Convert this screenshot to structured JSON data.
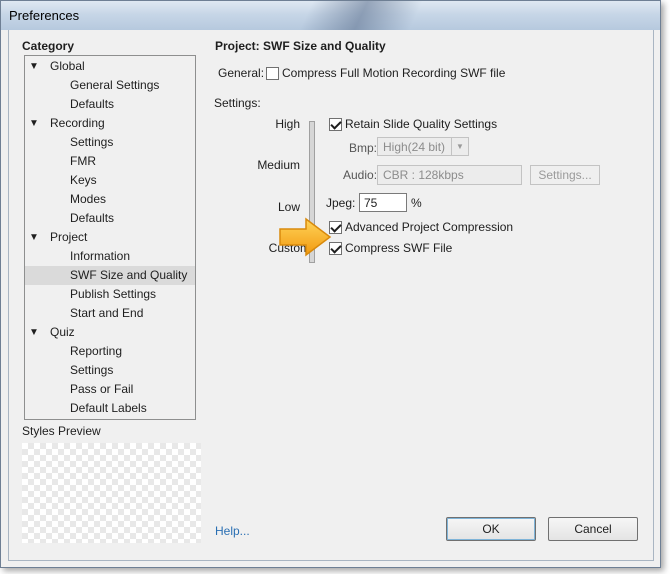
{
  "window": {
    "title": "Preferences"
  },
  "category": {
    "label": "Category",
    "items": [
      {
        "label": "Global",
        "level": 0,
        "expanded": true
      },
      {
        "label": "General Settings",
        "level": 1
      },
      {
        "label": "Defaults",
        "level": 1
      },
      {
        "label": "Recording",
        "level": 0,
        "expanded": true
      },
      {
        "label": "Settings",
        "level": 1
      },
      {
        "label": "FMR",
        "level": 1
      },
      {
        "label": "Keys",
        "level": 1
      },
      {
        "label": "Modes",
        "level": 1
      },
      {
        "label": "Defaults",
        "level": 1
      },
      {
        "label": "Project",
        "level": 0,
        "expanded": true
      },
      {
        "label": "Information",
        "level": 1
      },
      {
        "label": "SWF Size and Quality",
        "level": 1,
        "selected": true
      },
      {
        "label": "Publish Settings",
        "level": 1
      },
      {
        "label": "Start and End",
        "level": 1
      },
      {
        "label": "Quiz",
        "level": 0,
        "expanded": true
      },
      {
        "label": "Reporting",
        "level": 1
      },
      {
        "label": "Settings",
        "level": 1
      },
      {
        "label": "Pass or Fail",
        "level": 1
      },
      {
        "label": "Default Labels",
        "level": 1
      }
    ]
  },
  "styles_preview": {
    "label": "Styles Preview"
  },
  "panel": {
    "title": "Project: SWF Size and Quality",
    "general_label": "General:",
    "compress_fmr": {
      "label": "Compress Full Motion Recording SWF file",
      "checked": false
    },
    "settings_label": "Settings:",
    "slider": {
      "labels": {
        "high": "High",
        "medium": "Medium",
        "low": "Low",
        "custom": "Custom"
      },
      "selected": "Custom"
    },
    "retain_quality": {
      "label": "Retain Slide Quality Settings",
      "checked": true
    },
    "bmp": {
      "label": "Bmp:",
      "value": "High(24 bit)",
      "disabled": true
    },
    "audio": {
      "label": "Audio:",
      "value": "CBR : 128kbps",
      "disabled": true,
      "settings_button": "Settings..."
    },
    "jpeg": {
      "label": "Jpeg:",
      "value": "75",
      "unit": "%"
    },
    "advanced_compression": {
      "label": "Advanced Project Compression",
      "checked": true
    },
    "compress_swf": {
      "label": "Compress SWF File",
      "checked": true
    }
  },
  "footer": {
    "help": "Help...",
    "ok": "OK",
    "cancel": "Cancel"
  },
  "colors": {
    "selection": "#dadada",
    "link": "#2a6fb3",
    "callout_arrow": "#f6b21b"
  }
}
